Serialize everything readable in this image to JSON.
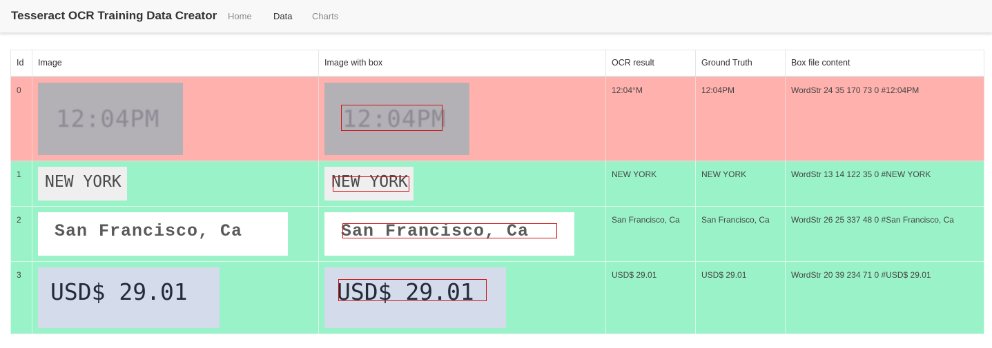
{
  "app": {
    "title": "Tesseract OCR Training Data Creator",
    "nav": [
      {
        "label": "Home",
        "active": false
      },
      {
        "label": "Data",
        "active": true
      },
      {
        "label": "Charts",
        "active": false
      }
    ]
  },
  "colors": {
    "row_mismatch": "#ffb1ad",
    "row_match": "#9af3c8",
    "box_outline": "#cc1010"
  },
  "table": {
    "headers": [
      "Id",
      "Image",
      "Image with box",
      "OCR result",
      "Ground Truth",
      "Box file content"
    ],
    "rows": [
      {
        "id": "0",
        "image_text": "12:04PM",
        "ocr_result": "12:04°M",
        "ground_truth": "12:04PM",
        "box_file": "WordStr 24 35 170 73 0 #12:04PM",
        "status": "mismatch"
      },
      {
        "id": "1",
        "image_text": "NEW YORK",
        "ocr_result": "NEW YORK",
        "ground_truth": "NEW YORK",
        "box_file": "WordStr 13 14 122 35 0 #NEW YORK",
        "status": "match"
      },
      {
        "id": "2",
        "image_text": "San Francisco, Ca",
        "ocr_result": "San Francisco, Ca",
        "ground_truth": "San Francisco, Ca",
        "box_file": "WordStr 26 25 337 48 0 #San Francisco, Ca",
        "status": "match"
      },
      {
        "id": "3",
        "image_text": "USD$ 29.01",
        "ocr_result": "USD$ 29.01",
        "ground_truth": "USD$ 29.01",
        "box_file": "WordStr 20 39 234 71 0 #USD$ 29.01",
        "status": "match"
      }
    ]
  }
}
